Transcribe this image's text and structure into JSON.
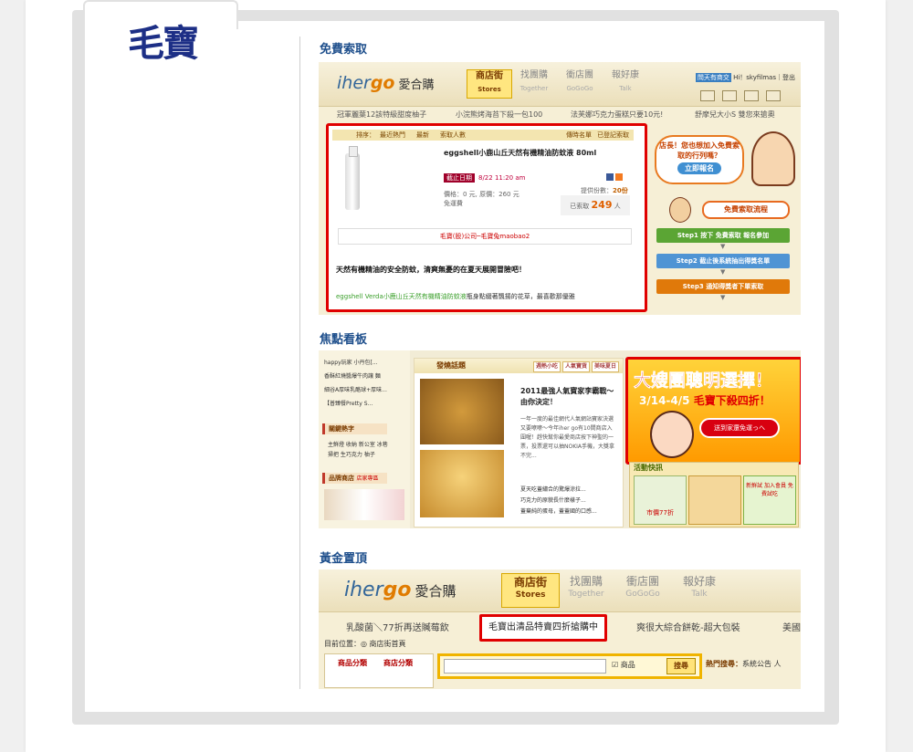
{
  "logo": {
    "text": "毛寶"
  },
  "sections": {
    "s1_title": "免費索取",
    "s2_title": "焦點看板",
    "s3_title": "黃金置頂"
  },
  "shot1": {
    "brand_latin_1": "iher",
    "brand_latin_2": "go",
    "brand_cn": "愛合購",
    "nav": [
      {
        "label": "商店街",
        "sub": "Stores"
      },
      {
        "label": "找團購",
        "sub": "Together"
      },
      {
        "label": "衝店團",
        "sub": "GoGoGo"
      },
      {
        "label": "報好康",
        "sub": "Talk"
      }
    ],
    "user_ask": "問天有商交",
    "user_text": "Hi！skyfilmas｜登出",
    "promos": [
      "冠軍麗葉12該特級甜度柚子",
      "小浣熊烤海苔下殺一包100",
      "法芙娜巧克力蛋糕只要10元!",
      "舒摩兒大小S 雙您來搶奧"
    ],
    "sort_label": "排序：",
    "sort_items": [
      "最近熱門",
      "最新",
      "索取人數"
    ],
    "sort_right": [
      "傳時名單",
      "已登記索取"
    ],
    "product_name": "eggshell小鹿山丘天然有機精油防蚊液 80ml",
    "deadline_badge": "截止日期",
    "deadline": "8/22  11:20 am",
    "price_line": "價格：0 元, 原價：260 元",
    "shipping": "免運費",
    "provide_label": "提供份數：",
    "provide_val": "20份",
    "applied_label": "已索取",
    "applied_val": "249",
    "applied_unit": "人",
    "company": "毛寶(股)公司─毛寶兔maobao2",
    "headline": "天然有機精油的安全防蚊，清爽無憂的在夏天展開冒險吧！",
    "body_green": "eggshell Verda小鹿山丘天然有機精油防蚊液",
    "body_rest": "瓶身點綴著飄揚的花草，最喜歡那優雅",
    "bubble": "店長！您也想加入免費索取的行列嗎？",
    "bubble_btn": "立即報名",
    "flow_title": "免費索取流程",
    "steps": [
      "Step1 按下 免費索取 報名參加",
      "Step2 截止後系統抽出得獎名單",
      "Step3 通知得獎者下單索取"
    ]
  },
  "shot2": {
    "list": [
      "happy玩家 小丹包[...",
      "香酥紅燒醬爆牛肉讓 麵",
      "細谷A厚味乳酪球+厚味...",
      "【普臻餐Pretty S..."
    ],
    "hot_head": "關鍵熱字",
    "hot_words": [
      "主鮮燈 收納 新公室 冰巷",
      "掃把 生巧克力 柚子"
    ],
    "brand_head": "品牌商店",
    "brand_tag": "店家專區",
    "mid_head": "發燒話題",
    "mini_tabs": [
      "週熱小吃",
      "人氣寶貨",
      "美味夏日"
    ],
    "mid_title": "2011最強人氣寶家李霸戰～由你決定！",
    "mid_body": "一年一度的最佳網代人氣網站寶家決選又要嘹嘹～今年iher go有10間商店入圍喔！趕快幫你最愛商店按下神聖的一票，投票還可以抽NOKIA手機，大獎拿不完...",
    "mid_links": [
      "夏天吃蓋繡合的驚爆涼拉...",
      "巧克力的原貌長什麼樣子...",
      "蓋棄純的蛋母，蓋蓋國的口感..."
    ],
    "ad_headline": "大嫂團聰明選擇！",
    "ad_date": "3/14-4/5",
    "ad_brand": "毛寶下殺四折！",
    "ad_btn": "送到家還免運っへ",
    "activity_head": "活動快訊",
    "act_labels": [
      "市價77折",
      "新鮮試 加入會員 免費試吃"
    ]
  },
  "shot3": {
    "brand_latin_1": "iher",
    "brand_latin_2": "go",
    "brand_cn": "愛合購",
    "nav": [
      {
        "label": "商店街",
        "sub": "Stores"
      },
      {
        "label": "找團購",
        "sub": "Together"
      },
      {
        "label": "衝店團",
        "sub": "GoGoGo"
      },
      {
        "label": "報好康",
        "sub": "Talk"
      }
    ],
    "promos": [
      "乳酸菌＼77折再送贓莓飲",
      "爽很大綜合餅乾-超大包裝",
      "美國"
    ],
    "red_promo": "毛寶出清品特賣四折搶購中",
    "location": "目前位置：◎ 商店街首頁",
    "cat_tabs": [
      "商品分類",
      "商店分類"
    ],
    "search_opt": "☑ 商品",
    "search_btn": "搜尋",
    "hot_label": "熱門搜尋：",
    "hot_text": "系統公告 人"
  }
}
